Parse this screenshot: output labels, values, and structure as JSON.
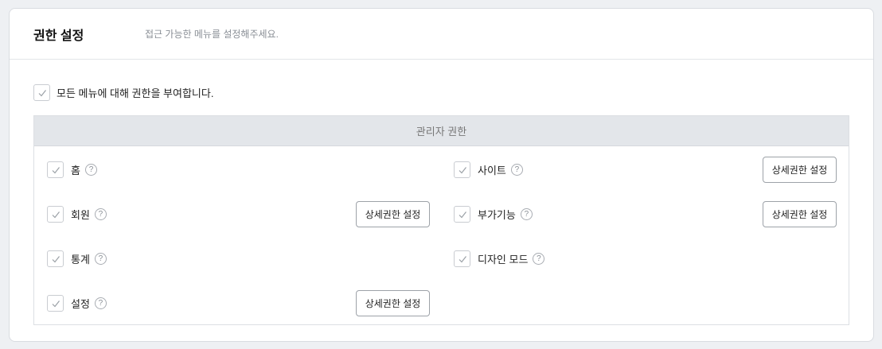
{
  "header": {
    "title": "권한 설정",
    "description": "접근 가능한 메뉴를 설정해주세요."
  },
  "all_permissions": {
    "label": "모든 메뉴에 대해 권한을 부여합니다.",
    "checked": true
  },
  "admin_section": {
    "title": "관리자 권한",
    "help_glyph": "?",
    "items": [
      {
        "label": "홈",
        "checked": true,
        "detail_button": ""
      },
      {
        "label": "사이트",
        "checked": true,
        "detail_button": "상세권한 설정"
      },
      {
        "label": "회원",
        "checked": true,
        "detail_button": "상세권한 설정"
      },
      {
        "label": "부가기능",
        "checked": true,
        "detail_button": "상세권한 설정"
      },
      {
        "label": "통계",
        "checked": true,
        "detail_button": ""
      },
      {
        "label": "디자인 모드",
        "checked": true,
        "detail_button": ""
      },
      {
        "label": "설정",
        "checked": true,
        "detail_button": "상세권한 설정"
      }
    ]
  },
  "colors": {
    "check": "#9aa0a6",
    "section_header_bg": "#e3e6ea"
  }
}
